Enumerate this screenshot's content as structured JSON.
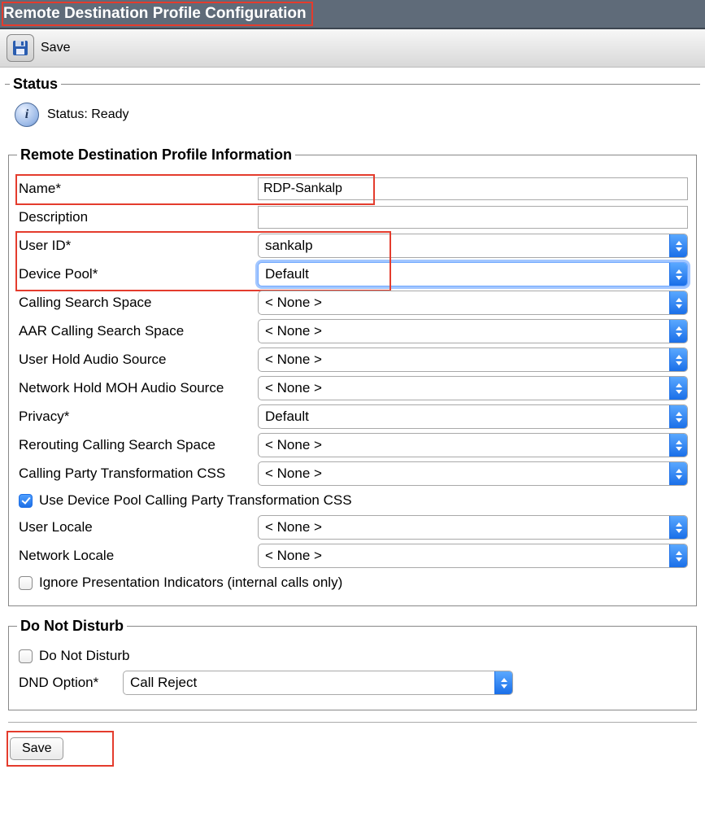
{
  "header": {
    "title": "Remote Destination Profile Configuration"
  },
  "toolbar": {
    "save_label": "Save"
  },
  "status": {
    "legend": "Status",
    "text": "Status: Ready"
  },
  "rdpi": {
    "legend": "Remote Destination Profile Information",
    "name_label": "Name",
    "name_value": "RDP-Sankalp",
    "description_label": "Description",
    "description_value": "",
    "user_id_label": "User ID",
    "user_id_value": "sankalp",
    "device_pool_label": "Device Pool",
    "device_pool_value": "Default",
    "css_label": "Calling Search Space",
    "css_value": "< None >",
    "aar_css_label": "AAR Calling Search Space",
    "aar_css_value": "< None >",
    "user_hold_label": "User Hold Audio Source",
    "user_hold_value": "< None >",
    "network_hold_label": "Network Hold MOH Audio Source",
    "network_hold_value": "< None >",
    "privacy_label": "Privacy",
    "privacy_value": "Default",
    "rerouting_css_label": "Rerouting Calling Search Space",
    "rerouting_css_value": "< None >",
    "cpt_css_label": "Calling Party Transformation CSS",
    "cpt_css_value": "< None >",
    "use_device_pool_cpt_label": "Use Device Pool Calling Party Transformation CSS",
    "user_locale_label": "User Locale",
    "user_locale_value": "< None >",
    "network_locale_label": "Network Locale",
    "network_locale_value": "< None >",
    "ignore_pi_label": "Ignore Presentation Indicators (internal calls only)"
  },
  "dnd": {
    "legend": "Do Not Disturb",
    "dnd_checkbox_label": "Do Not Disturb",
    "dnd_option_label": "DND Option",
    "dnd_option_value": "Call Reject"
  },
  "footer": {
    "save_label": "Save"
  },
  "asterisk": "*"
}
